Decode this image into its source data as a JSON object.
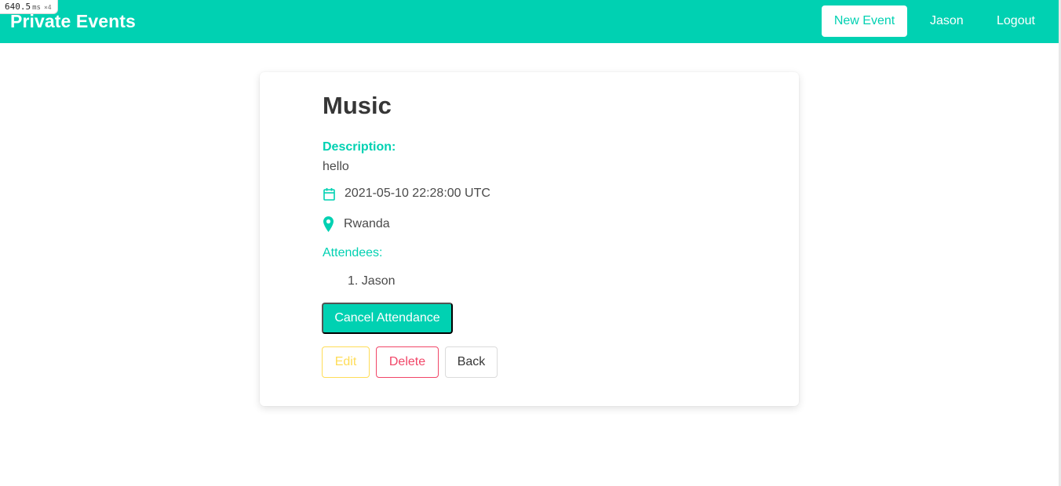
{
  "perf": {
    "value": "640.5",
    "unit": "ms",
    "multiplier": "×4"
  },
  "navbar": {
    "brand": "Private Events",
    "new_event_label": "New Event",
    "user_label": "Jason",
    "logout_label": "Logout",
    "background": "#00d1b2"
  },
  "event": {
    "title": "Music",
    "description_label": "Description:",
    "description": "hello",
    "date_icon": "calendar-icon",
    "date": "2021-05-10 22:28:00 UTC",
    "location_icon": "map-marker-icon",
    "location": "Rwanda",
    "attendees_label": "Attendees:",
    "attendees": [
      "1. Jason"
    ]
  },
  "actions": {
    "cancel_attendance": "Cancel Attendance",
    "edit": "Edit",
    "delete": "Delete",
    "back": "Back"
  },
  "colors": {
    "primary": "#00d1b2",
    "warning": "#ffdd57",
    "danger": "#f14668",
    "text": "#363636"
  }
}
